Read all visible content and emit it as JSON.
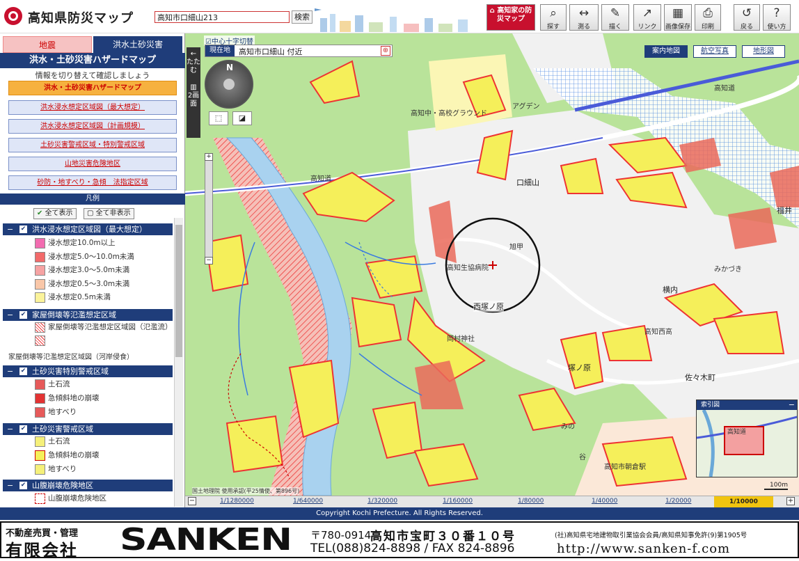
{
  "app": {
    "title": "高知県防災マップ",
    "search_value": "高知市口細山213",
    "search_btn": "検索"
  },
  "toolbar": [
    {
      "label": "高知家の防災マップ",
      "icon": "home-icon"
    },
    {
      "label": "探す",
      "icon": "magnifier-icon"
    },
    {
      "label": "測る",
      "icon": "ruler-icon"
    },
    {
      "label": "描く",
      "icon": "pencil-icon"
    },
    {
      "label": "リンク",
      "icon": "link-icon"
    },
    {
      "label": "画像保存",
      "icon": "save-icon"
    },
    {
      "label": "印刷",
      "icon": "printer-icon"
    },
    {
      "label": "戻る",
      "icon": "undo-icon"
    },
    {
      "label": "使い方",
      "icon": "help-icon"
    }
  ],
  "side": {
    "tab_earthquake": "地震",
    "tab_flood": "洪水土砂災害",
    "panel_title": "洪水・土砂災害ハザードマップ",
    "subtitle": "情報を切り替えて確認しましょう",
    "menu": [
      "洪水・土砂災害ハザードマップ",
      "洪水浸水想定区域図（最大想定）",
      "洪水浸水想定区域図（計画規模）",
      "土砂災害警戒区域・特別警戒区域",
      "山地災害危険地区",
      "砂防・地すべり・急傾　法指定区域"
    ],
    "legend_title": "凡例",
    "show_all": "全て表示",
    "hide_all": "全て非表示",
    "groups": [
      {
        "title": "洪水浸水想定区域図（最大想定）",
        "items": [
          {
            "label": "浸水想定10.0m以上",
            "color": "#f26cb0"
          },
          {
            "label": "浸水想定5.0～10.0m未満",
            "color": "#f26a6a"
          },
          {
            "label": "浸水想定3.0～5.0m未満",
            "color": "#f6a3a3"
          },
          {
            "label": "浸水想定0.5～3.0m未満",
            "color": "#f9c7a8"
          },
          {
            "label": "浸水想定0.5m未満",
            "color": "#fbf39a"
          }
        ]
      },
      {
        "title": "家屋倒壊等氾濫想定区域",
        "items": [
          {
            "label": "家屋倒壊等氾濫想定区域図（氾濫流）",
            "color": "#e33"
          }
        ],
        "note": "家屋倒壊等氾濫想定区域図（河岸侵食）"
      },
      {
        "title": "土砂災害特別警戒区域",
        "items": [
          {
            "label": "土石流",
            "color": "#e65a5a"
          },
          {
            "label": "急傾斜地の崩壊",
            "color": "#e33333"
          },
          {
            "label": "地すべり",
            "color": "#e65a5a"
          }
        ]
      },
      {
        "title": "土砂災害警戒区域",
        "items": [
          {
            "label": "土石流",
            "color": "#f5f07a"
          },
          {
            "label": "急傾斜地の崩壊",
            "color": "#f5f05a"
          },
          {
            "label": "地すべり",
            "color": "#f5f07a"
          }
        ]
      },
      {
        "title": "山腹崩壊危険地区",
        "items": [
          {
            "label": "山腹崩壊危険地区",
            "color": "#ffffff"
          }
        ]
      }
    ]
  },
  "map": {
    "collapse": "たたむ",
    "dual": "2画面",
    "center_toggle": "中心十字切替",
    "loc_key": "現在地",
    "loc_value": "高知市口細山 付近",
    "base": [
      "案内地図",
      "航空写真",
      "地形図"
    ],
    "compass_n": "N",
    "labels": [
      "口細山",
      "福井",
      "旭甲",
      "高知生協病院",
      "西塚ノ原",
      "塚ノ原",
      "横内",
      "佐々木町",
      "高知西高",
      "みかづき",
      "高知中・高校グラウンド",
      "アグデン",
      "高知道",
      "高知道",
      "岡村神社",
      "高知市朝倉駅",
      "みの",
      "谷"
    ],
    "index_title": "索引図",
    "index_route": "高知道",
    "scale": "100m",
    "copyright_small": "国土地理院 使用承認(平25情使、第896号)",
    "zoom_levels": [
      "1/1280000",
      "1/640000",
      "1/320000",
      "1/160000",
      "1/80000",
      "1/40000",
      "1/20000",
      "1/10000"
    ],
    "zoom_current": "1/10000"
  },
  "copyright": "Copyright Kochi Prefecture. All Rights Reserved.",
  "footer": {
    "tag": "不動産売買・管理",
    "company": "有限会社",
    "brand": "SANKEN",
    "postal": "〒780-0914",
    "address": "高知市宝町３０番１０号",
    "tel": "TEL(088)824-8898 / FAX 824-8896",
    "assoc": "(社)高知県宅地建物取引業協会会員/高知県知事免許(9)第1905号",
    "url": "http://www.sanken-f.com"
  }
}
